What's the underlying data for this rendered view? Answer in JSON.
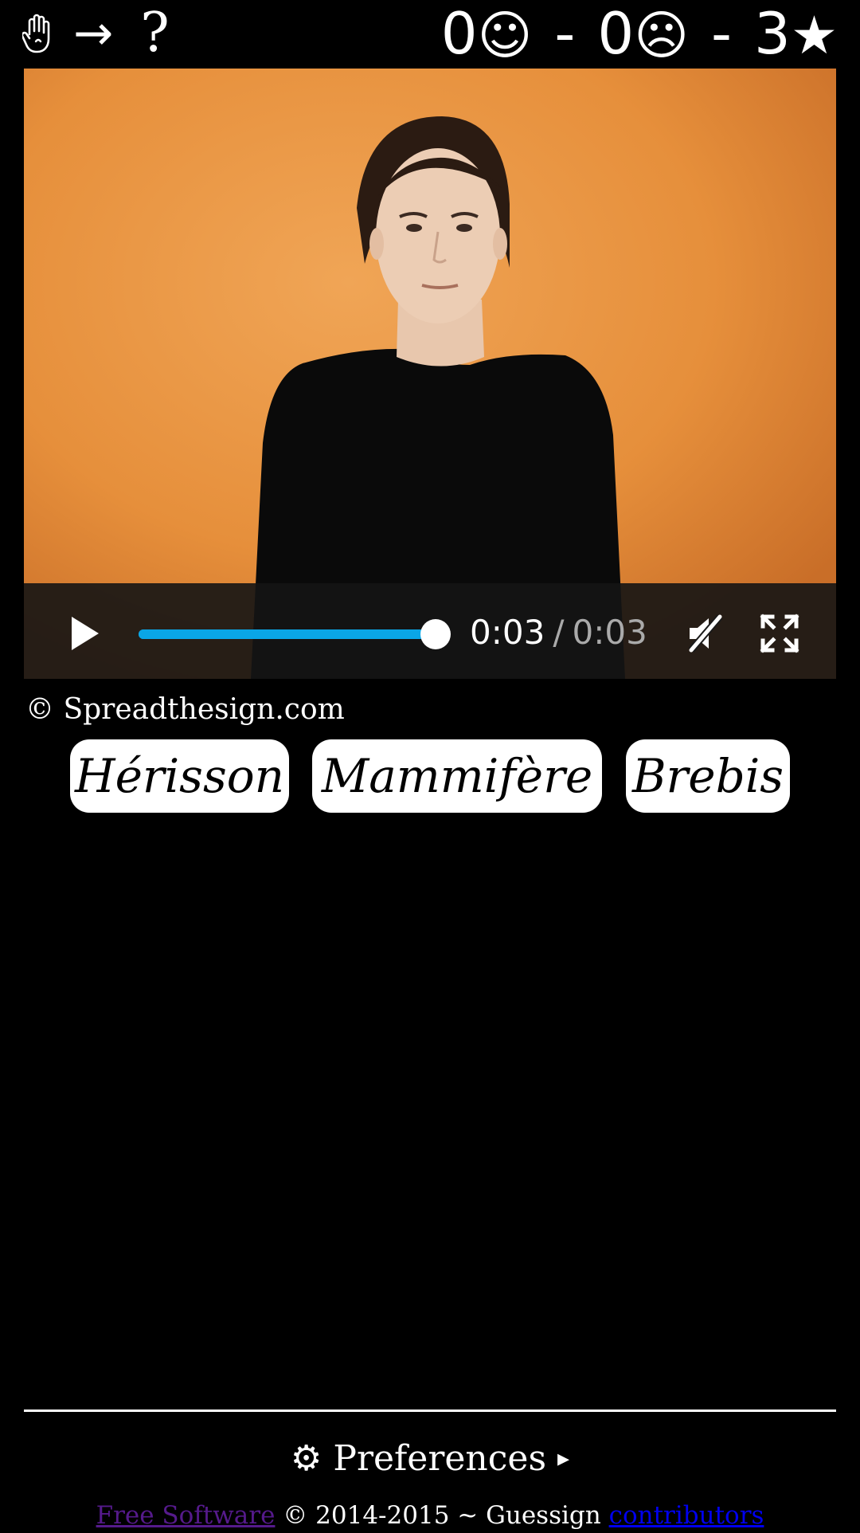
{
  "mode": {
    "hand_icon": "raised-hand-icon",
    "arrow": "→",
    "question": "?"
  },
  "score": {
    "correct_count": "0",
    "correct_icon": "☺",
    "separator1": "-",
    "wrong_count": "0",
    "wrong_icon": "☹",
    "separator2": "-",
    "stars_count": "3",
    "star_icon": "★"
  },
  "player": {
    "current_time": "0:03",
    "slash": "/",
    "duration": "0:03",
    "progress": 1.0,
    "muted": true,
    "accent_color": "#0aa6e6"
  },
  "credit": "© Spreadthesign.com",
  "choices": [
    "Hérisson",
    "Mammifère",
    "Brebis"
  ],
  "preferences": {
    "icon": "⚙",
    "label": "Preferences",
    "caret": "▸"
  },
  "footer": {
    "free_software": "Free Software",
    "middle": " © 2014-2015 ~ Guessign ",
    "contributors": "contributors"
  }
}
